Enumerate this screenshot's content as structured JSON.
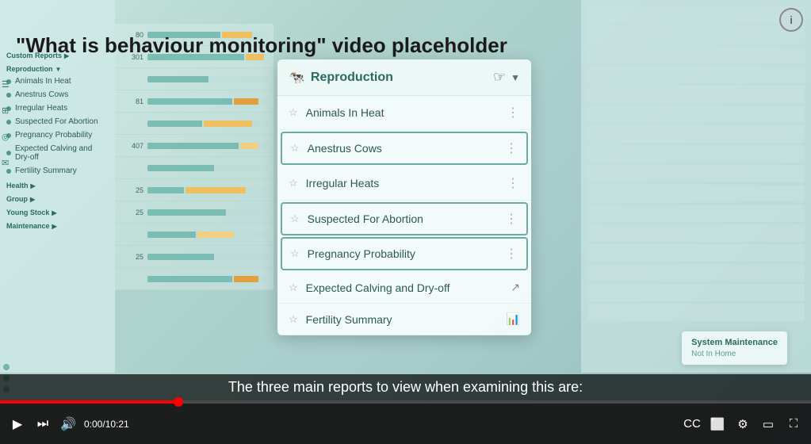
{
  "video": {
    "placeholder_text": "\"What is behaviour monitoring\" video placeholder",
    "time_current": "0:00",
    "time_total": "10:21",
    "time_display": "0:00/10:21",
    "progress_percent": 22
  },
  "dropdown": {
    "header_title": "Reproduction",
    "items": [
      {
        "label": "Animals In Heat",
        "highlighted": false,
        "icon": "dots"
      },
      {
        "label": "Anestrus Cows",
        "highlighted": true,
        "icon": "dots"
      },
      {
        "label": "Irregular Heats",
        "highlighted": false,
        "icon": "dots"
      },
      {
        "label": "Suspected For Abortion",
        "highlighted": true,
        "icon": "dots"
      },
      {
        "label": "Pregnancy Probability",
        "highlighted": true,
        "icon": "dots"
      },
      {
        "label": "Expected Calving and Dry-off",
        "highlighted": false,
        "icon": "chart"
      },
      {
        "label": "Fertility Summary",
        "highlighted": false,
        "icon": "chart"
      }
    ]
  },
  "sidebar": {
    "sections": [
      {
        "label": "Custom Reports"
      },
      {
        "label": "Reproduction"
      },
      {
        "label": "Animals In Heat"
      },
      {
        "label": "Anestrus Cows"
      },
      {
        "label": "Irregular Heats"
      },
      {
        "label": "Suspected For Abortion"
      },
      {
        "label": "Pregnancy Probability"
      },
      {
        "label": "Expected Calving and Dry-off"
      },
      {
        "label": "Fertility Summary"
      },
      {
        "label": "Health"
      },
      {
        "label": "Group"
      },
      {
        "label": "Young Stock"
      },
      {
        "label": "Maintenance"
      }
    ]
  },
  "system_maintenance": {
    "title": "System Maintenance",
    "status": "Not In Home"
  },
  "subtitle": {
    "text": "The three main reports to view when examining this are:"
  },
  "controls": {
    "play_label": "▶",
    "skip_label": "⏭",
    "volume_label": "🔊",
    "cc_label": "CC",
    "miniplayer_label": "⬜",
    "settings_label": "⚙",
    "theater_label": "▭",
    "fullscreen_label": "⛶",
    "cast_label": "⬤"
  },
  "info_btn": {
    "label": "i"
  }
}
